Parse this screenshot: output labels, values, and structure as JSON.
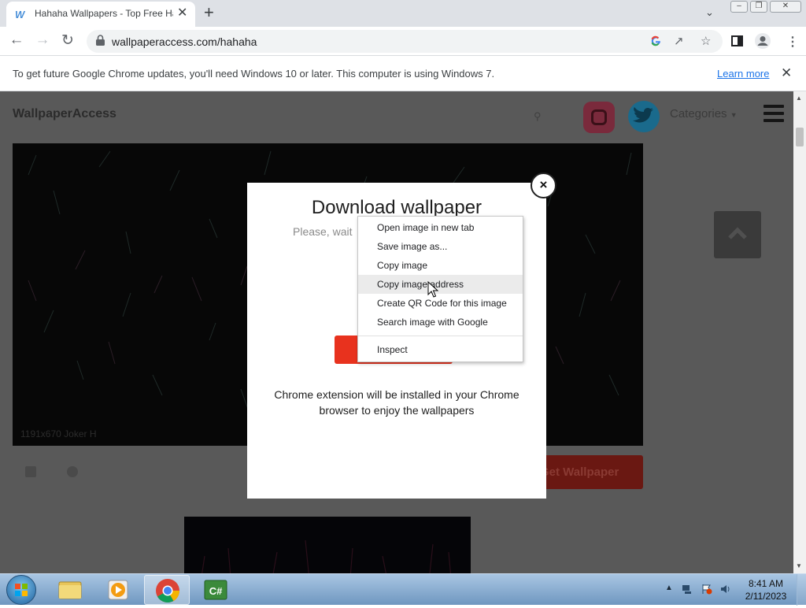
{
  "browser": {
    "tab_favicon": "W",
    "tab_title": "Hahaha Wallpapers - Top Free Hahaha Backgrounds",
    "tab_close": "✕",
    "new_tab": "+",
    "url": "wallpaperaccess.com/hahaha"
  },
  "infobar": {
    "message": "To get future Google Chrome updates, you'll need Windows 10 or later. This computer is using Windows 7.",
    "link": "Learn more"
  },
  "page": {
    "logo": "WallpaperAccess",
    "categories": "Categories",
    "hero_caption": "1191x670 Joker H",
    "get_wallpaper": "Get Wallpaper"
  },
  "modal": {
    "close": "×",
    "title": "Download wallpaper",
    "wait_text": "Please, wait",
    "note": "Chrome extension will be installed in your Chrome browser to enjoy the wallpapers"
  },
  "context_menu": {
    "items": [
      "Open image in new tab",
      "Save image as...",
      "Copy image",
      "Copy image address",
      "Create QR Code for this image",
      "Search image with Google",
      "Inspect"
    ]
  },
  "taskbar": {
    "time": "8:41 AM",
    "date": "2/11/2023",
    "apps": [
      "file-explorer",
      "media-player",
      "chrome",
      "csharp-ide"
    ]
  },
  "colors": {
    "modal_button": "#e8321e",
    "link": "#1a73e8",
    "page_overlay": "#595959"
  }
}
